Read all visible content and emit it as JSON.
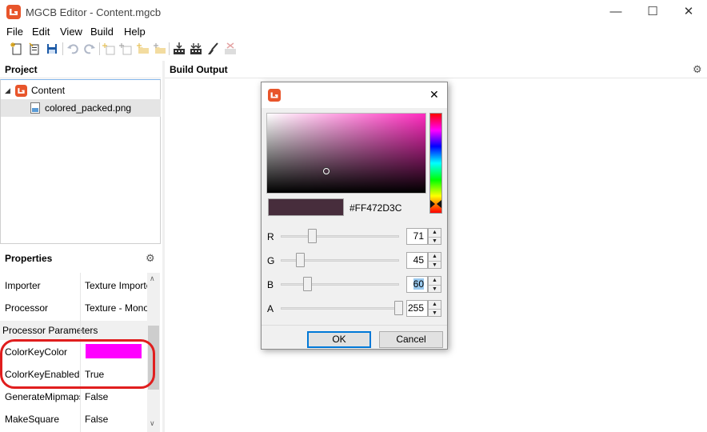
{
  "window": {
    "title": "MGCB Editor - Content.mgcb",
    "minimize": "—",
    "maximize": "☐",
    "close": "✕"
  },
  "menu": [
    "File",
    "Edit",
    "View",
    "Build",
    "Help"
  ],
  "toolbar_icons": [
    "new-file-icon",
    "open-file-icon",
    "save-icon",
    "undo-icon",
    "redo-icon",
    "new-item-icon",
    "add-existing-icon",
    "new-folder-icon",
    "add-folder-icon",
    "build-icon",
    "rebuild-icon",
    "clean-icon",
    "cancel-build-icon"
  ],
  "panes": {
    "project": "Project",
    "build_output": "Build Output",
    "properties": "Properties"
  },
  "tree": {
    "root": "Content",
    "file": "colored_packed.png"
  },
  "properties": {
    "rows": [
      {
        "name": "Importer",
        "value": "Texture Importer"
      },
      {
        "name": "Processor",
        "value": "Texture - MonoGame"
      }
    ],
    "section": "Processor Parameters",
    "params": [
      {
        "name": "ColorKeyColor",
        "value": "",
        "color": "#FF00FF"
      },
      {
        "name": "ColorKeyEnabled",
        "value": "True"
      },
      {
        "name": "GenerateMipmaps",
        "value": "False"
      },
      {
        "name": "MakeSquare",
        "value": "False"
      }
    ]
  },
  "color_dialog": {
    "close": "✕",
    "hex": "#FF472D3C",
    "current_color": "#472D3C",
    "hue_color": "#FF2BBF",
    "channels": [
      {
        "label": "R",
        "value": "71",
        "fraction": 0.278
      },
      {
        "label": "G",
        "value": "45",
        "fraction": 0.176
      },
      {
        "label": "B",
        "value": "60",
        "fraction": 0.235,
        "selected": true
      },
      {
        "label": "A",
        "value": "255",
        "fraction": 1.0
      }
    ],
    "ok": "OK",
    "cancel": "Cancel"
  },
  "colors": {
    "accent_orange": "#E8552B",
    "annotation_red": "#E01E1E",
    "selection": "#99C9EF"
  }
}
